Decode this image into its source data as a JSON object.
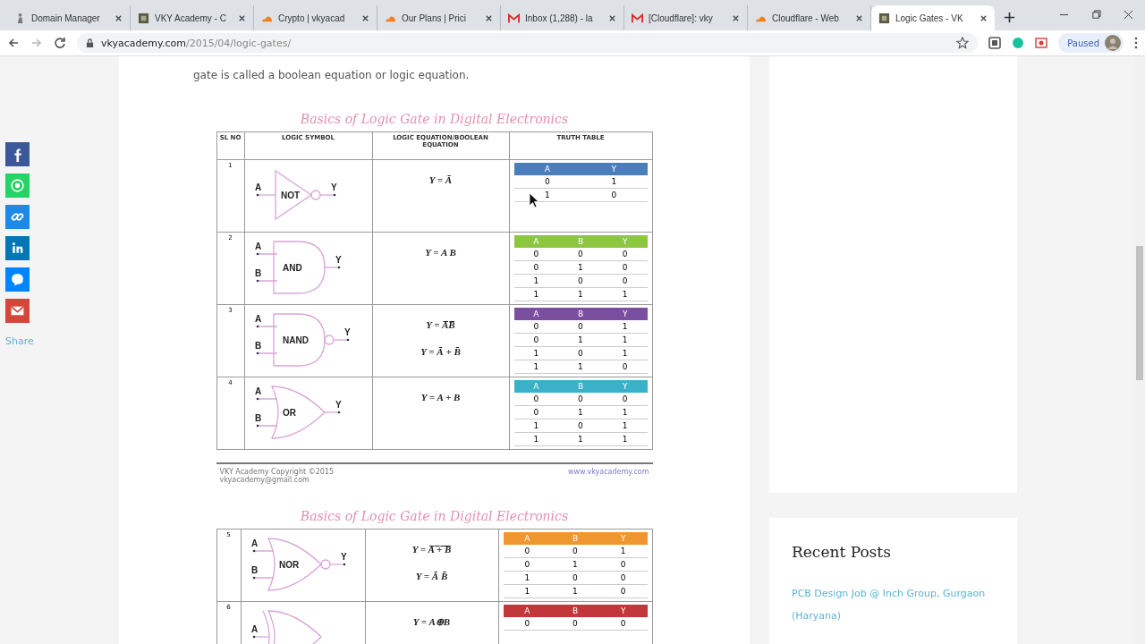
{
  "browser": {
    "tabs": [
      {
        "title": "Domain Manager",
        "kind": "figure",
        "selected": false
      },
      {
        "title": "VKY Academy - C",
        "kind": "thumb",
        "selected": false
      },
      {
        "title": "Crypto | vkyacad",
        "kind": "cloud",
        "selected": false
      },
      {
        "title": "Our Plans | Prici",
        "kind": "cloud",
        "selected": false
      },
      {
        "title": "Inbox (1,288) - la",
        "kind": "mail",
        "selected": false
      },
      {
        "title": "[Cloudflare]: vky",
        "kind": "mail",
        "selected": false
      },
      {
        "title": "Cloudflare - Web",
        "kind": "cloud",
        "selected": false
      },
      {
        "title": "Logic Gates - VK",
        "kind": "thumb",
        "selected": true
      }
    ],
    "url_host": "vkyacademy.com",
    "url_path": "/2015/04/logic-gates/",
    "profile_label": "Paused"
  },
  "share_bar": {
    "buttons": [
      {
        "kind": "facebook"
      },
      {
        "kind": "whatsapp"
      },
      {
        "kind": "link"
      },
      {
        "kind": "linkedin"
      },
      {
        "kind": "messenger"
      },
      {
        "kind": "gmail"
      }
    ],
    "label": "Share"
  },
  "article": {
    "paragraph": "gate is called a boolean equation or logic equation.",
    "figures": [
      {
        "title": "Basics of Logic Gate in Digital Electronics",
        "columns": [
          "SL NO",
          "LOGIC SYMBOL",
          "LOGIC EQUATION/BOOLEAN EQUATION",
          "TRUTH TABLE"
        ],
        "rows": [
          {
            "sl": "1",
            "kind": "not",
            "gate": "NOT",
            "inputs": [
              "A"
            ],
            "output": "Y",
            "equations": [
              "Y = Ā"
            ],
            "truth": {
              "color": "#4a7ebb",
              "headers": [
                "A",
                "Y"
              ],
              "rows": [
                [
                  "0",
                  "1"
                ],
                [
                  "1",
                  "0"
                ]
              ]
            }
          },
          {
            "sl": "2",
            "kind": "and",
            "gate": "AND",
            "inputs": [
              "A",
              "B"
            ],
            "output": "Y",
            "equations": [
              "Y = A B"
            ],
            "truth": {
              "color": "#8dc63f",
              "headers": [
                "A",
                "B",
                "Y"
              ],
              "rows": [
                [
                  "0",
                  "0",
                  "0"
                ],
                [
                  "0",
                  "1",
                  "0"
                ],
                [
                  "1",
                  "0",
                  "0"
                ],
                [
                  "1",
                  "1",
                  "1"
                ]
              ]
            }
          },
          {
            "sl": "3",
            "kind": "nand",
            "gate": "NAND",
            "inputs": [
              "A",
              "B"
            ],
            "output": "Y",
            "equations": [
              "Y = A̅B̅",
              "Y = Ā + B̄"
            ],
            "truth": {
              "color": "#7b4fa0",
              "headers": [
                "A",
                "B",
                "Y"
              ],
              "rows": [
                [
                  "0",
                  "0",
                  "1"
                ],
                [
                  "0",
                  "1",
                  "1"
                ],
                [
                  "1",
                  "0",
                  "1"
                ],
                [
                  "1",
                  "1",
                  "0"
                ]
              ]
            }
          },
          {
            "sl": "4",
            "kind": "or",
            "gate": "OR",
            "inputs": [
              "A",
              "B"
            ],
            "output": "Y",
            "equations": [
              "Y = A + B"
            ],
            "truth": {
              "color": "#3bb0c9",
              "headers": [
                "A",
                "B",
                "Y"
              ],
              "rows": [
                [
                  "0",
                  "0",
                  "0"
                ],
                [
                  "0",
                  "1",
                  "1"
                ],
                [
                  "1",
                  "0",
                  "1"
                ],
                [
                  "1",
                  "1",
                  "1"
                ]
              ]
            }
          }
        ],
        "footer": {
          "left": [
            "VKY Academy Copyright ©2015",
            "vkyacademy@gmail.com"
          ],
          "right": "www.vkyacademy.com"
        }
      },
      {
        "title": "Basics of Logic Gate in Digital Electronics",
        "rows": [
          {
            "sl": "5",
            "kind": "nor",
            "gate": "NOR",
            "inputs": [
              "A",
              "B"
            ],
            "output": "Y",
            "equations": [
              "Y = A̅ ̅+̅ ̅B̅",
              "Y = Ā B̄"
            ],
            "truth": {
              "color": "#f0962e",
              "headers": [
                "A",
                "B",
                "Y"
              ],
              "rows": [
                [
                  "0",
                  "0",
                  "1"
                ],
                [
                  "0",
                  "1",
                  "0"
                ],
                [
                  "1",
                  "0",
                  "0"
                ],
                [
                  "1",
                  "1",
                  "0"
                ]
              ]
            }
          },
          {
            "sl": "6",
            "kind": "xor",
            "inputs": [
              "A"
            ],
            "equations": [
              "Y = A⊕B"
            ],
            "truth": {
              "color": "#c1373a",
              "headers": [
                "A",
                "B",
                "Y"
              ],
              "rows": [
                [
                  "0",
                  "0",
                  "0"
                ]
              ]
            }
          }
        ]
      }
    ]
  },
  "sidebar": {
    "recent_posts": {
      "title": "Recent Posts",
      "links": [
        "PCB Design Job @ Inch Group, Gurgaon (Haryana)"
      ]
    }
  }
}
